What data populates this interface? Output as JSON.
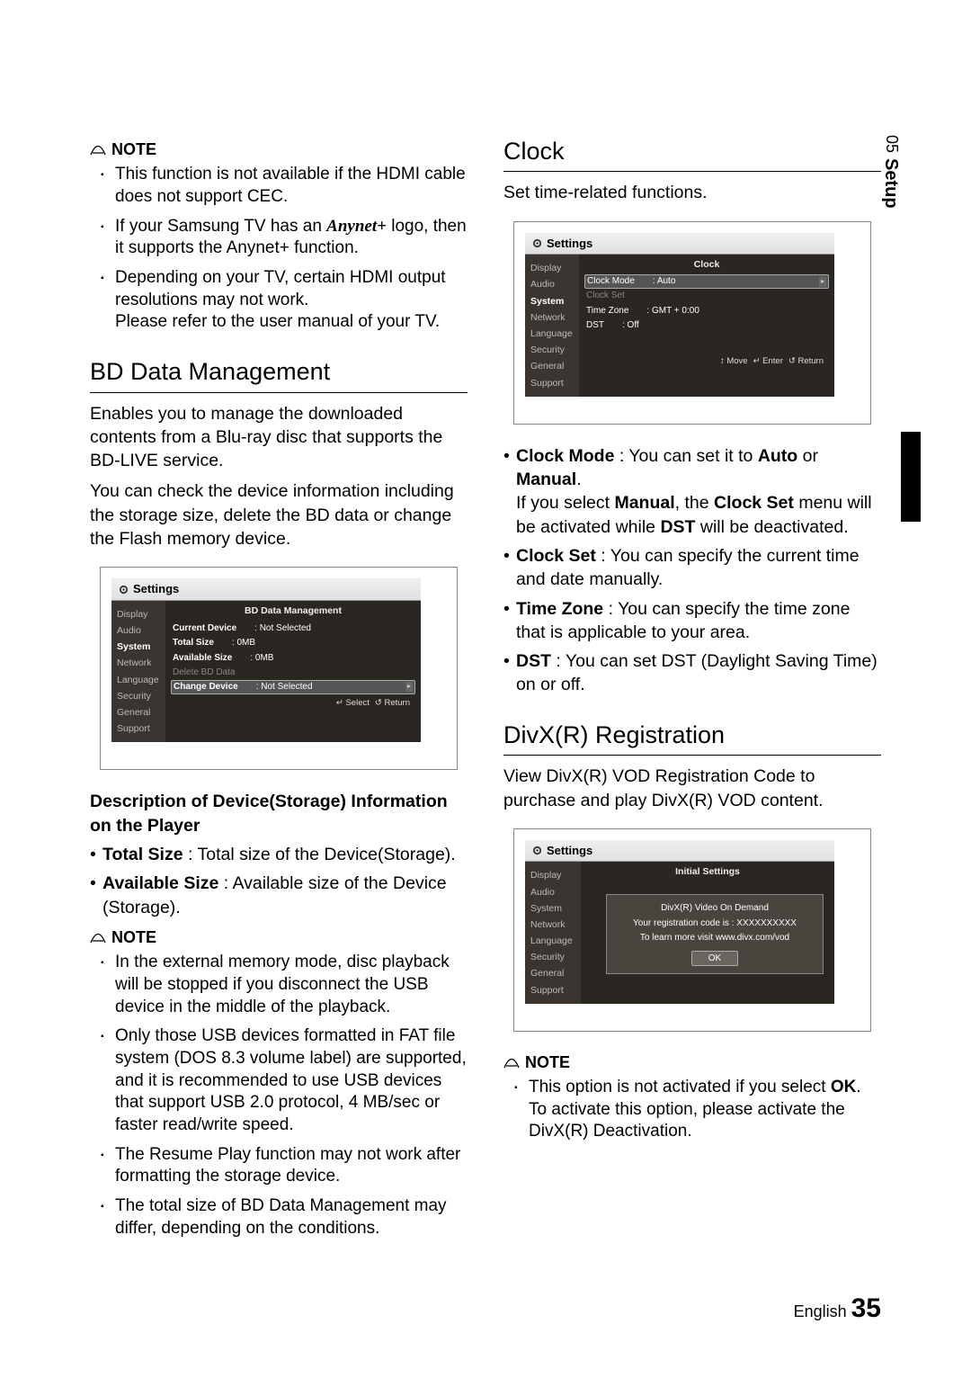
{
  "page": {
    "chapter_num": "05",
    "chapter_name": "Setup",
    "footer_lang": "English",
    "footer_page": "35"
  },
  "left": {
    "note_label": "NOTE",
    "notes1": [
      "This function is not available if the HDMI cable does not support CEC.",
      "If your Samsung TV has an ___ logo, then it supports the Anynet+ function.",
      "Depending on your TV, certain HDMI output resolutions may not work.\nPlease refer to the user manual of your TV."
    ],
    "anynet_logo": "Anynet+",
    "heading1": "BD Data Management",
    "para1a": "Enables you to manage the downloaded contents from a Blu-ray disc that supports the BD-LIVE service.",
    "para1b": "You can check the device information including the storage size, delete the BD data or change the Flash memory device.",
    "shot1": {
      "settings_label": "Settings",
      "menu": [
        "Display",
        "Audio",
        "System",
        "Network",
        "Language",
        "Security",
        "General",
        "Support"
      ],
      "active": "System",
      "title": "BD Data Management",
      "rows": [
        {
          "k": "Current Device",
          "v": ": Not Selected",
          "k_bold": true
        },
        {
          "k": "Total Size",
          "v": ": 0MB",
          "k_bold": true
        },
        {
          "k": "Available Size",
          "v": ": 0MB",
          "k_bold": true
        },
        {
          "k": "Delete BD Data",
          "v": "",
          "disabled": true
        },
        {
          "k": "Change Device",
          "v": ": Not Selected",
          "sel": true,
          "arrow": true,
          "k_bold": true
        }
      ],
      "hints": [
        {
          "i": "↵",
          "t": "Select"
        },
        {
          "i": "↺",
          "t": "Return"
        }
      ]
    },
    "desc_title": "Description of Device(Storage) Information on the Player",
    "bullets1": [
      {
        "b": "Total Size",
        "t": " : Total size of the Device(Storage)."
      },
      {
        "b": "Available Size",
        "t": " : Available size of the Device (Storage)."
      }
    ],
    "notes2": [
      "In the external memory mode, disc playback will be stopped if you disconnect the USB device in the middle of the playback.",
      "Only those USB devices formatted in FAT file system (DOS 8.3 volume label) are supported, and it is recommended to use USB devices that support USB 2.0 protocol, 4 MB/sec or faster read/write speed.",
      "The Resume Play function may not work after formatting the storage device.",
      "The total size of BD Data Management may differ, depending on the conditions."
    ]
  },
  "right": {
    "heading1": "Clock",
    "para1": "Set time-related functions.",
    "shot2": {
      "settings_label": "Settings",
      "menu": [
        "Display",
        "Audio",
        "System",
        "Network",
        "Language",
        "Security",
        "General",
        "Support"
      ],
      "active": "System",
      "title": "Clock",
      "rows": [
        {
          "k": "Clock Mode",
          "v": ": Auto",
          "sel": true,
          "arrow": true
        },
        {
          "k": "Clock Set",
          "v": "",
          "disabled": true
        },
        {
          "k": "Time Zone",
          "v": ": GMT + 0:00"
        },
        {
          "k": "DST",
          "v": ": Off"
        }
      ],
      "hints": [
        {
          "i": "↕",
          "t": "Move"
        },
        {
          "i": "↵",
          "t": "Enter"
        },
        {
          "i": "↺",
          "t": "Return"
        }
      ]
    },
    "bullets1": [
      {
        "b": "Clock Mode",
        "t": " : You can set it to ",
        "b2": "Auto",
        "t2": " or ",
        "b3": "Manual",
        "t3": ".",
        "extra": "If you select Manual, the Clock Set menu will be activated while DST will be deactivated.",
        "extra_bold": [
          "Manual",
          "Clock Set",
          "DST"
        ]
      },
      {
        "b": "Clock Set",
        "t": " : You can specify the current time and date manually."
      },
      {
        "b": "Time Zone",
        "t": " : You can specify the time zone that is applicable to your area."
      },
      {
        "b": "DST",
        "t": " : You can set DST (Daylight Saving Time) on or off."
      }
    ],
    "heading2": "DivX(R) Registration",
    "para2": "View DivX(R) VOD Registration Code to purchase and play DivX(R) VOD content.",
    "shot3": {
      "settings_label": "Settings",
      "menu": [
        "Display",
        "Audio",
        "System",
        "Network",
        "Language",
        "Security",
        "General",
        "Support"
      ],
      "title": "Initial Settings",
      "modal_lines": [
        "DivX(R) Video On Demand",
        "Your registration code is : XXXXXXXXXX",
        "To learn more visit www.divx.com/vod"
      ],
      "ok": "OK"
    },
    "note_label": "NOTE",
    "notes1": [
      "This option is not activated if you select OK. To activate this option, please activate the DivX(R) Deactivation."
    ],
    "notes1_bold": "OK"
  }
}
